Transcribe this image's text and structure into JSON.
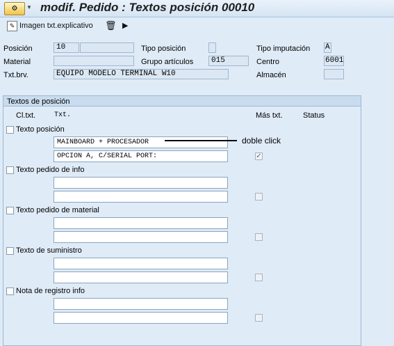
{
  "title": "modif. Pedido : Textos posición 00010",
  "toolbar": {
    "image_button_label": "Imagen txt.explicativo",
    "delete_symbol": "🗑",
    "next_symbol": "▶"
  },
  "header": {
    "posicion_label": "Posición",
    "posicion_value": "10",
    "tipo_posicion_label": "Tipo posición",
    "tipo_imputacion_label": "Tipo imputación",
    "tipo_imputacion_value": "A",
    "material_label": "Material",
    "grupo_articulos_label": "Grupo artículos",
    "grupo_articulos_value": "015",
    "centro_label": "Centro",
    "centro_value": "6001",
    "txtbrv_label": "Txt.brv.",
    "txtbrv_value": "EQUIPO MODELO TERMINAL W10",
    "almacen_label": "Almacén"
  },
  "panel": {
    "title": "Textos de posición",
    "col_cltxt": "Cl.txt.",
    "col_txt": "Txt.",
    "col_mas_txt": "Más txt.",
    "col_status": "Status",
    "sections": [
      {
        "label": "Texto posición",
        "line1": "MAINBOARD + PROCESADOR",
        "line2": "OPCION A, C/SERIAL PORT:",
        "more_checked": true
      },
      {
        "label": "Texto pedido de info",
        "line1": "",
        "line2": "",
        "more_checked": false
      },
      {
        "label": "Texto pedido de material",
        "line1": "",
        "line2": "",
        "more_checked": false
      },
      {
        "label": "Texto de suministro",
        "line1": "",
        "line2": "",
        "more_checked": false
      },
      {
        "label": "Nota de registro info",
        "line1": "",
        "line2": "",
        "more_checked": false
      }
    ]
  },
  "annotation": "doble click",
  "colors": {
    "background": "#dfebf7",
    "panel_header": "#c9dcef",
    "field_readonly": "#dbe7f3"
  }
}
